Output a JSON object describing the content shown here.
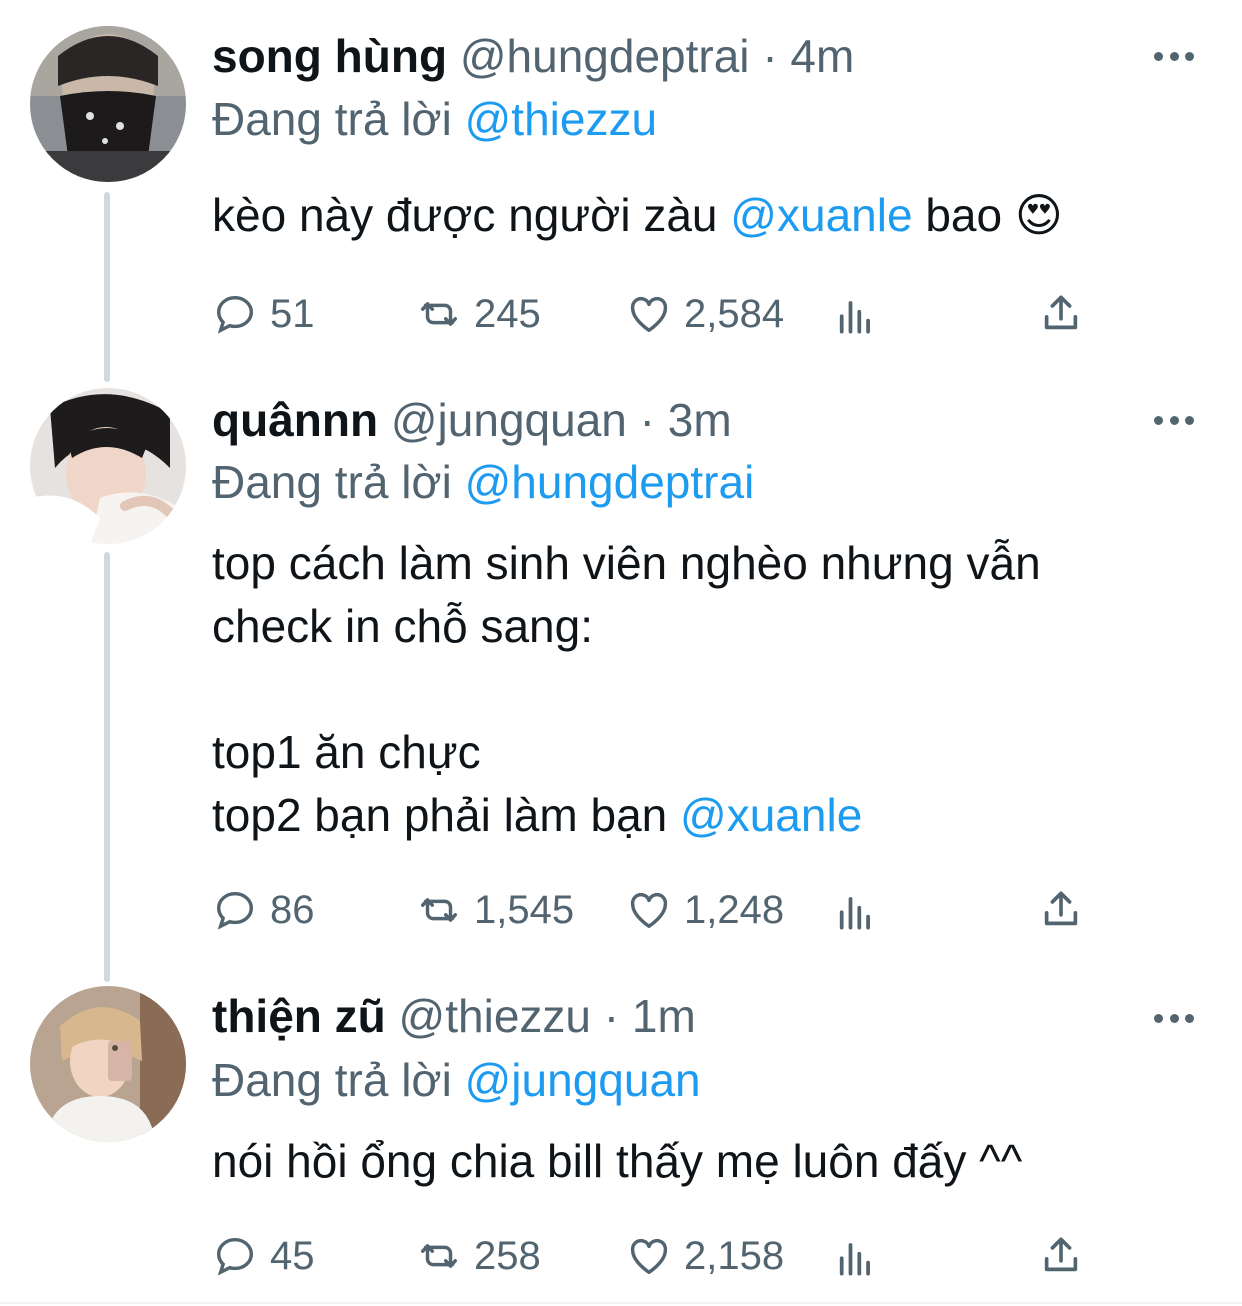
{
  "replying_prefix": "Đang trả lời",
  "tweets": [
    {
      "name": "song hùng",
      "handle": "@hungdeptrai",
      "separator": "·",
      "time": "4m",
      "replying_to": "@thiezzu",
      "text_parts": [
        "kèo này được người zàu ",
        "@xuanle",
        " bao 😍"
      ],
      "replies": "51",
      "retweets": "245",
      "likes": "2,584"
    },
    {
      "name": "quânnn",
      "handle": "@jungquan",
      "separator": "·",
      "time": "3m",
      "replying_to": "@hungdeptrai",
      "lines": [
        "top cách làm sinh viên nghèo nhưng vẫn",
        "check in chỗ sang:",
        "",
        "top1 ăn chực"
      ],
      "last_line_parts": [
        "top2 bạn phải làm bạn ",
        "@xuanle"
      ],
      "replies": "86",
      "retweets": "1,545",
      "likes": "1,248"
    },
    {
      "name": "thiện zũ",
      "handle": "@thiezzu",
      "separator": "·",
      "time": "1m",
      "replying_to": "@jungquan",
      "text": "nói hồi ổng chia bill thấy mẹ luôn đấy ^^",
      "replies": "45",
      "retweets": "258",
      "likes": "2,158"
    }
  ],
  "colors": {
    "accent": "#1d9bf0",
    "secondary": "#536471",
    "text": "#0f1419",
    "thread_line": "#cfd9de"
  },
  "icons": [
    "reply-icon",
    "retweet-icon",
    "like-icon",
    "stats-icon",
    "share-icon",
    "more-icon"
  ]
}
